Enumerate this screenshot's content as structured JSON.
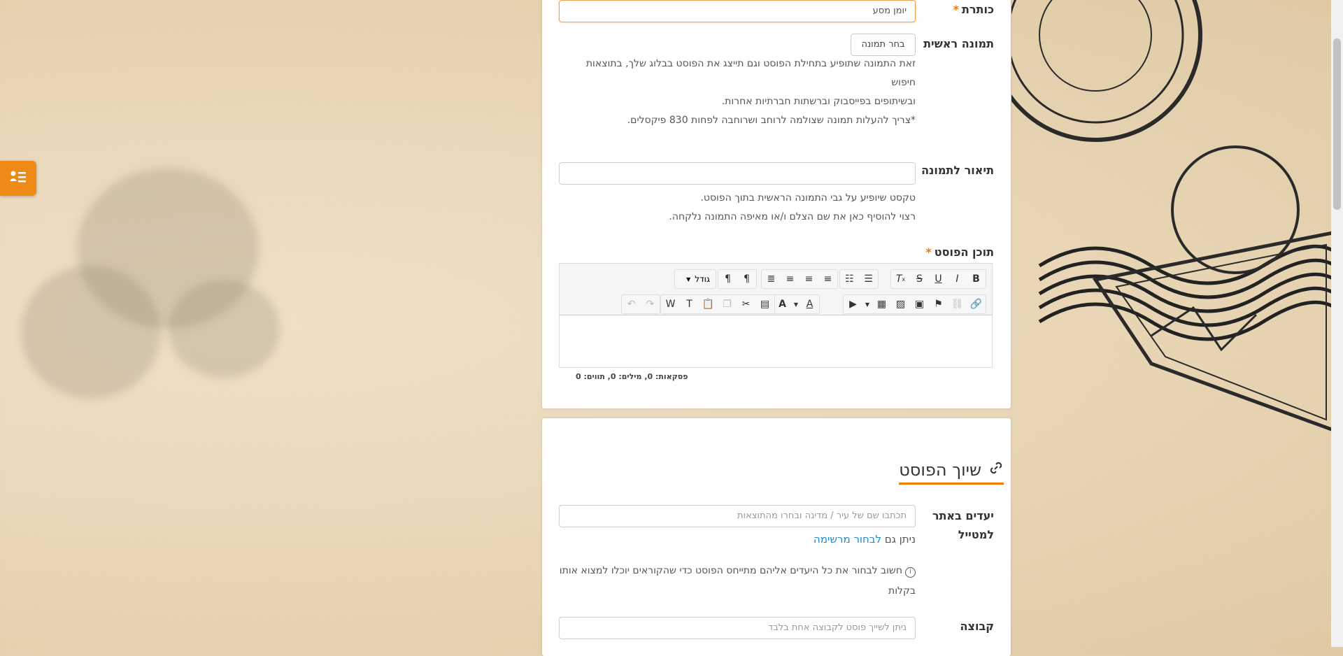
{
  "colors": {
    "accent": "#f07a00",
    "link": "#1a8bd0"
  },
  "side_tab": {
    "icon": "user-list-icon"
  },
  "form": {
    "title": {
      "label": "כותרת",
      "required_mark": "*",
      "value": "יומן מסע"
    },
    "main_image": {
      "label": "תמונה ראשית",
      "button": "בחר תמונה",
      "help_lines": [
        "זאת התמונה שתופיע בתחילת הפוסט וגם תייצג את הפוסט בבלוג שלך, בתוצאות חיפוש",
        "ובשיתופים בפייסבוק וברשתות חברתיות אחרות.",
        "*צריך להעלות תמונה שצולמה לרוחב ושרוחבה לפחות 830 פיקסלים."
      ]
    },
    "image_caption": {
      "label": "תיאור לתמונה",
      "value": "",
      "help_lines": [
        "טקסט שיופיע על גבי התמונה הראשית בתוך הפוסט.",
        "רצוי להוסיף כאן את שם הצלם ו/או מאיפה התמונה נלקחה."
      ]
    },
    "content": {
      "label": "תוכן הפוסט",
      "required_mark": "*",
      "font_size_select": "גודל",
      "stats": "פסקאות: 0, מילים: 0, תווים: 0"
    }
  },
  "association": {
    "title": "שיוך הפוסט",
    "destinations": {
      "label_line1": "יעדים באתר",
      "label_line2": "למטייל",
      "placeholder": "תכתבו שם של עיר / מדינה ובחרו מהתוצאות",
      "hint_prefix": "ניתן גם",
      "hint_link": "לבחור מרשימה",
      "note": "חשוב לבחור את כל היעדים אליהם מתייחס הפוסט כדי שהקוראים יוכלו למצוא אותו בקלות"
    },
    "group": {
      "label": "קבוצה",
      "placeholder": "ניתן לשייך פוסט לקבוצה אחת בלבד"
    }
  }
}
